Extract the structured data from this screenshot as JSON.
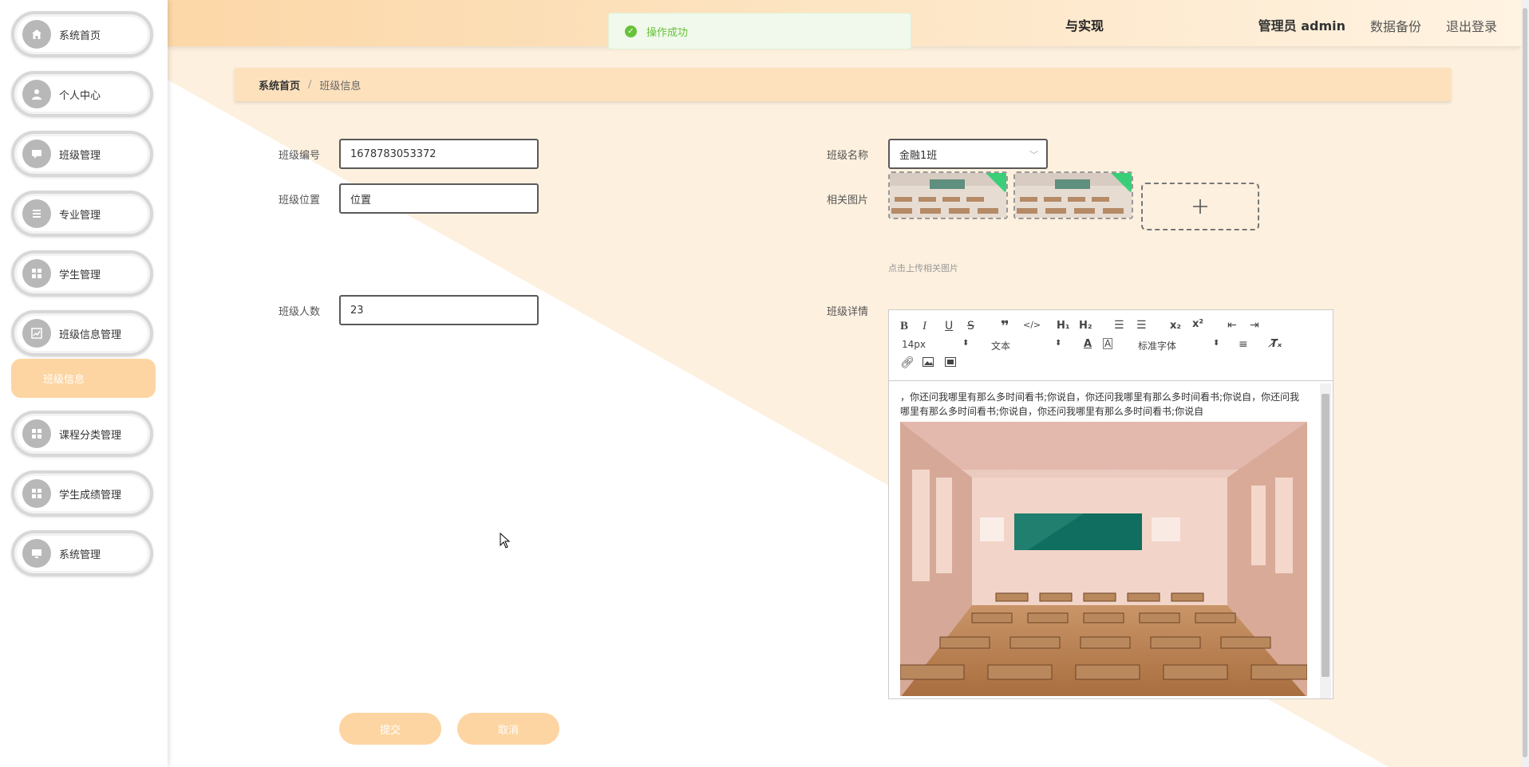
{
  "sidebar": {
    "items": [
      {
        "label": "系统首页",
        "icon": "home-icon"
      },
      {
        "label": "个人中心",
        "icon": "user-icon"
      },
      {
        "label": "班级管理",
        "icon": "chat-icon"
      },
      {
        "label": "专业管理",
        "icon": "list-icon"
      },
      {
        "label": "学生管理",
        "icon": "grid-icon"
      },
      {
        "label": "班级信息管理",
        "icon": "chart-icon"
      },
      {
        "label": "课程分类管理",
        "icon": "grid-icon"
      },
      {
        "label": "学生成绩管理",
        "icon": "grid-icon"
      },
      {
        "label": "系统管理",
        "icon": "monitor-icon"
      }
    ],
    "sub_item": "班级信息"
  },
  "header": {
    "title_fragment": "与实现",
    "admin": "管理员 admin",
    "backup": "数据备份",
    "logout": "退出登录"
  },
  "toast": {
    "message": "操作成功",
    "color": "#67c23a"
  },
  "breadcrumb": {
    "home": "系统首页",
    "separator": "/",
    "current": "班级信息"
  },
  "form": {
    "class_no_label": "班级编号",
    "class_no_value": "1678783053372",
    "class_name_label": "班级名称",
    "class_name_value": "金融1班",
    "location_label": "班级位置",
    "location_value": "位置",
    "images_label": "相关图片",
    "upload_tip": "点击上传相关图片",
    "count_label": "班级人数",
    "count_value": "23",
    "detail_label": "班级详情",
    "submit": "提交",
    "cancel": "取消"
  },
  "editor": {
    "font_size": "14px",
    "paragraph": "文本",
    "font_family": "标准字体",
    "content": "，你还问我哪里有那么多时间看书;你说自，你还问我哪里有那么多时间看书;你说自，你还问我哪里有那么多时间看书;你说自，你还问我哪里有那么多时间看书;你说自"
  },
  "colors": {
    "accent": "#fdd5a2",
    "topbar": "#fcd7a7",
    "success": "#67c23a"
  }
}
